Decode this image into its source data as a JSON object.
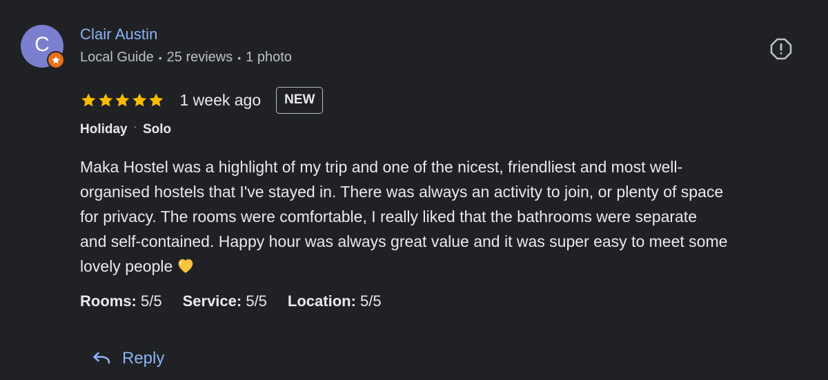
{
  "author": {
    "initial": "C",
    "name": "Clair Austin",
    "guide_label": "Local Guide",
    "reviews": "25 reviews",
    "photos": "1 photo",
    "separator": "•"
  },
  "review": {
    "stars": 5,
    "max_stars": 5,
    "time": "1 week ago",
    "badge": "NEW",
    "trip_type": "Holiday",
    "trip_dot": "·",
    "travel_group": "Solo",
    "text": "Maka Hostel was a highlight of my trip and one of the nicest, friendliest and most well-\norganised hostels that I've stayed in. There was always an activity to join, or plenty of space\nfor privacy. The rooms were comfortable, I really liked that the bathrooms were separate\nand self-contained. Happy hour was always great value and it was super easy to meet some\nlovely people",
    "emoji": "yellow-heart-icon",
    "ratings": [
      {
        "label": "Rooms:",
        "value": "5/5"
      },
      {
        "label": "Service:",
        "value": "5/5"
      },
      {
        "label": "Location:",
        "value": "5/5"
      }
    ]
  },
  "actions": {
    "reply_label": "Reply",
    "report_icon": "report-icon"
  },
  "colors": {
    "background": "#202124",
    "link": "#8ab4f8",
    "star": "#fbbc04",
    "avatar": "#7b7fd0",
    "guide_badge": "#e8711a"
  }
}
